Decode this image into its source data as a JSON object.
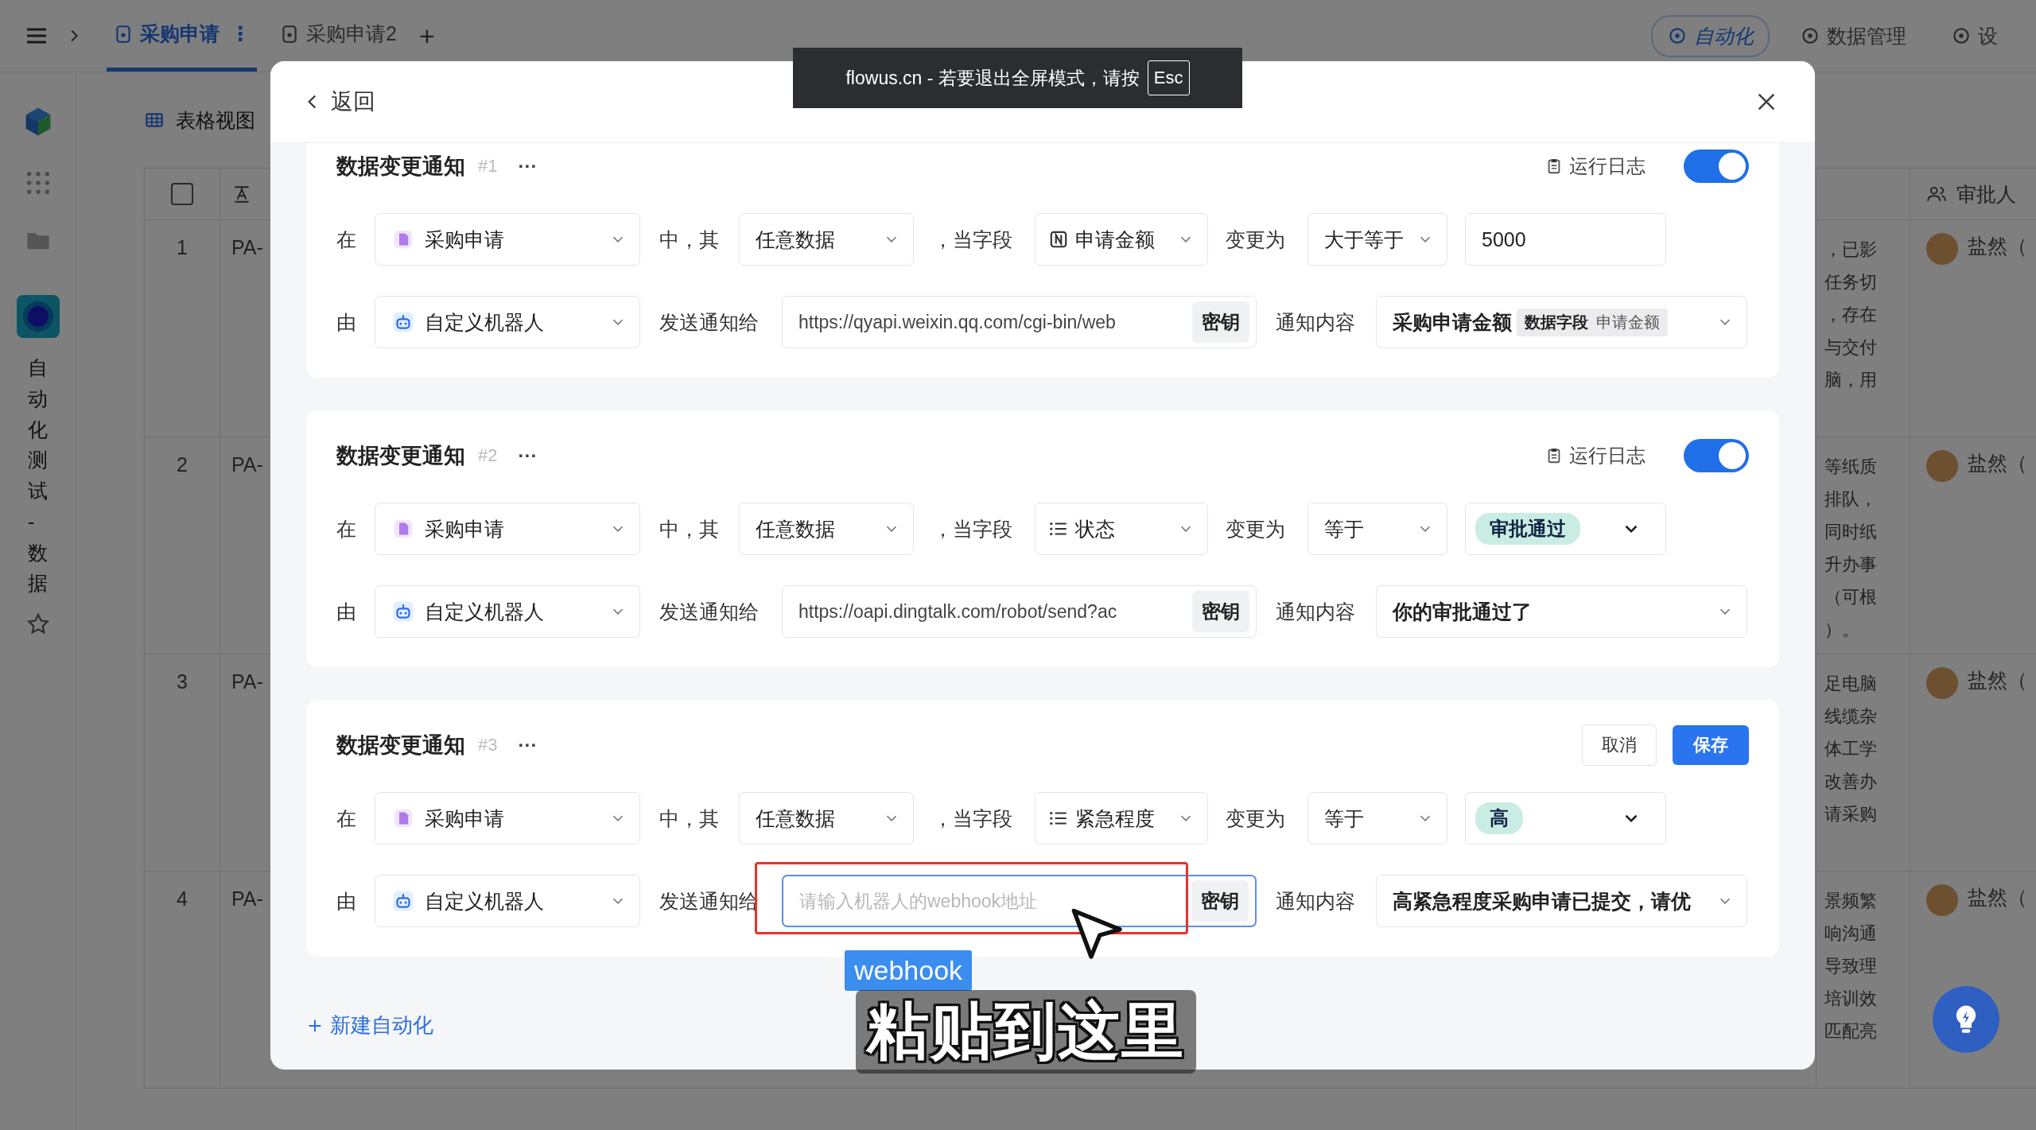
{
  "topbar": {
    "tabs": [
      {
        "label": "采购申请",
        "selected": true,
        "menu": "⋮"
      },
      {
        "label": "采购申请2",
        "selected": false
      }
    ],
    "add": "+",
    "actions": [
      {
        "label": "自动化",
        "selected": true
      },
      {
        "label": "数据管理",
        "selected": false
      },
      {
        "label": "设",
        "selected": false
      }
    ]
  },
  "view": {
    "label": "表格视图"
  },
  "sidebar": {
    "workspace": "自动化测试-数据"
  },
  "table": {
    "select_all": {
      "checked": false
    },
    "approver_header": "审批人",
    "rows": [
      {
        "number": "1",
        "id": "PA-",
        "notes": [
          "，已影",
          "任务切",
          "，存在",
          "与交付",
          "脑，用"
        ],
        "approver": "盐然（"
      },
      {
        "number": "2",
        "id": "PA-",
        "notes": [
          "等纸质",
          "排队，",
          "同时纸",
          "升办事",
          "（可根",
          "）。"
        ],
        "approver": "盐然（"
      },
      {
        "number": "3",
        "id": "PA-",
        "notes": [
          "足电脑",
          "线缆杂",
          "体工学",
          "改善办",
          "请采购"
        ],
        "approver": "盐然（"
      },
      {
        "number": "4",
        "id": "PA-",
        "notes": [
          "景频繁",
          "响沟通",
          "导致理",
          "培训效",
          "匹配亮"
        ],
        "approver": "盐然（"
      }
    ]
  },
  "modal": {
    "back": "返回",
    "automations": [
      {
        "kind": "saved",
        "title": "数据变更通知",
        "number": "#1",
        "more": "···",
        "log": "运行日志",
        "toggle": {
          "on": true
        },
        "condition": {
          "in": "在",
          "source": "采购申请",
          "which": "中，其",
          "scope": "任意数据",
          "when": "，当字段",
          "field": {
            "kind": "number",
            "label": "申请金额"
          },
          "becomes": "变更为",
          "operator": "大于等于",
          "value": {
            "kind": "text",
            "text": "5000"
          }
        },
        "action": {
          "by": "由",
          "robot": "自定义机器人",
          "send": "发送通知给",
          "webhook": {
            "value": "https://qyapi.weixin.qq.com/cgi-bin/web",
            "focused": false,
            "highlighted": false
          },
          "secret": "密钥",
          "content_label": "通知内容",
          "content": [
            {
              "kind": "text",
              "text": "采购申请金额"
            },
            {
              "kind": "chip",
              "label": "数据字段",
              "text": "申请金额"
            }
          ]
        }
      },
      {
        "kind": "saved",
        "title": "数据变更通知",
        "number": "#2",
        "more": "···",
        "log": "运行日志",
        "toggle": {
          "on": true
        },
        "condition": {
          "in": "在",
          "source": "采购申请",
          "which": "中，其",
          "scope": "任意数据",
          "when": "，当字段",
          "field": {
            "kind": "list",
            "label": "状态"
          },
          "becomes": "变更为",
          "operator": "等于",
          "value": {
            "kind": "tag",
            "text": "审批通过"
          }
        },
        "action": {
          "by": "由",
          "robot": "自定义机器人",
          "send": "发送通知给",
          "webhook": {
            "value": "https://oapi.dingtalk.com/robot/send?ac",
            "focused": false,
            "highlighted": false
          },
          "secret": "密钥",
          "content_label": "通知内容",
          "content": [
            {
              "kind": "text",
              "text": "你的审批通过了"
            }
          ]
        }
      },
      {
        "kind": "editing",
        "title": "数据变更通知",
        "number": "#3",
        "more": "···",
        "cancel": "取消",
        "save": "保存",
        "condition": {
          "in": "在",
          "source": "采购申请",
          "which": "中，其",
          "scope": "任意数据",
          "when": "，当字段",
          "field": {
            "kind": "list",
            "label": "紧急程度"
          },
          "becomes": "变更为",
          "operator": "等于",
          "value": {
            "kind": "tag",
            "text": "高"
          }
        },
        "action": {
          "by": "由",
          "robot": "自定义机器人",
          "send": "发送通知给",
          "webhook": {
            "placeholder": "请输入机器人的webhook地址",
            "focused": true,
            "highlighted": true
          },
          "secret": "密钥",
          "content_label": "通知内容",
          "content": [
            {
              "kind": "text",
              "text": "高紧急程度采购申请已提交，请优"
            }
          ]
        }
      }
    ],
    "new_automation": "新建自动化"
  },
  "toast": {
    "text": "flowus.cn - 若要退出全屏模式，请按",
    "key": "Esc"
  },
  "captions": {
    "tag": "webhook",
    "subtitle": "粘贴到这里"
  }
}
